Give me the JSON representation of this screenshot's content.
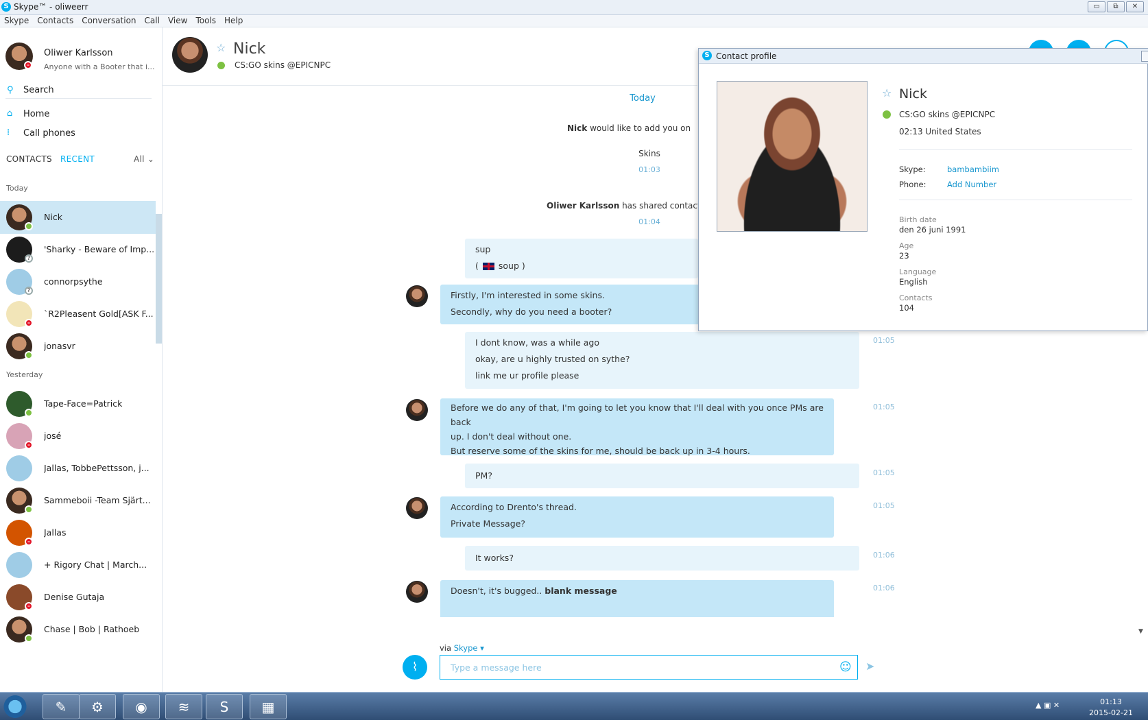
{
  "window": {
    "title": "Skype™ - oliweerr",
    "min": "▭",
    "max": "⧉",
    "close": "✕"
  },
  "menu": [
    "Skype",
    "Contacts",
    "Conversation",
    "Call",
    "View",
    "Tools",
    "Help"
  ],
  "me": {
    "name": "Oliwer Karlsson",
    "mood": "Anyone with a Booter that i..."
  },
  "search_label": "Search",
  "nav": {
    "home": "Home",
    "call_phones": "Call phones"
  },
  "tabs": {
    "contacts": "CONTACTS",
    "recent": "RECENT",
    "all": "All ⌄"
  },
  "sections": {
    "today": "Today",
    "yesterday": "Yesterday"
  },
  "contacts_today": [
    {
      "name": "Nick",
      "status": "online"
    },
    {
      "name": "'Sharky - Beware of Imp...",
      "status": "unknown"
    },
    {
      "name": "connorpsythe",
      "status": "unknown"
    },
    {
      "name": "`R2Pleasent Gold[ASK F...",
      "status": "busy"
    },
    {
      "name": "jonasvr",
      "status": "online"
    }
  ],
  "contacts_yesterday": [
    {
      "name": "Tape-Face=Patrick",
      "status": "online"
    },
    {
      "name": "josé",
      "status": "busy"
    },
    {
      "name": "Jallas, TobbePettsson, j...",
      "status": "none"
    },
    {
      "name": "Sammeboii -Team Sjärt...",
      "status": "online"
    },
    {
      "name": "Jallas",
      "status": "busy"
    },
    {
      "name": "+ Rigory Chat | March...",
      "status": "none"
    },
    {
      "name": "Denise Gutaja",
      "status": "busy"
    },
    {
      "name": "Chase | Bob | Rathoeb",
      "status": "online"
    }
  ],
  "header": {
    "name": "Nick",
    "mood": "CS:GO skins @EPICNPC"
  },
  "chat": {
    "date": "Today",
    "request_name": "Nick",
    "request_text": "would like to add you on",
    "request_msg": "Skins",
    "request_time": "01:03",
    "share_name": "Oliwer Karlsson",
    "share_text": "has shared contact de",
    "share_time": "01:04",
    "m1": [
      "sup",
      "soup )"
    ],
    "m1_prefix": "(",
    "m2": [
      "Firstly, I'm interested in some skins.",
      "Secondly, why do you need a booter?"
    ],
    "m3": [
      "I dont know, was a while ago",
      "okay, are u highly trusted on sythe?",
      "link me ur profile please"
    ],
    "m3_time": "01:05",
    "m4": [
      "Before we do any of that, I'm going to let you know that I'll deal with you once PMs are back",
      "up. I don't deal without one.",
      "But reserve some of the skins for me, should be back up in 3-4 hours."
    ],
    "m4_time": "01:05",
    "m5": "PM?",
    "m5_time": "01:05",
    "m6": [
      "According to Drento's thread.",
      "Private Message?"
    ],
    "m6_time": "01:05",
    "m7": "It works?",
    "m7_time": "01:06",
    "m8_text": "Doesn't, it's bugged..",
    "m8_bold": "blank message",
    "m8_time": "01:06"
  },
  "composer": {
    "via": "via",
    "via_service": "Skype ▾",
    "placeholder": "Type a message here"
  },
  "profile": {
    "title": "Contact profile",
    "name": "Nick",
    "mood": "CS:GO skins @EPICNPC",
    "local": "02:13 United States",
    "skype_label": "Skype:",
    "skype_value": "bambambiim",
    "phone_label": "Phone:",
    "phone_value": "Add Number",
    "birth_label": "Birth date",
    "birth_value": "den 26 juni 1991",
    "age_label": "Age",
    "age_value": "23",
    "lang_label": "Language",
    "lang_value": "English",
    "contacts_label": "Contacts",
    "contacts_value": "104"
  },
  "taskbar": {
    "time": "01:13",
    "date": "2015-02-21"
  },
  "colors": {
    "accent": "#00aff0",
    "online": "#7dc142",
    "busy": "#e3172a"
  }
}
